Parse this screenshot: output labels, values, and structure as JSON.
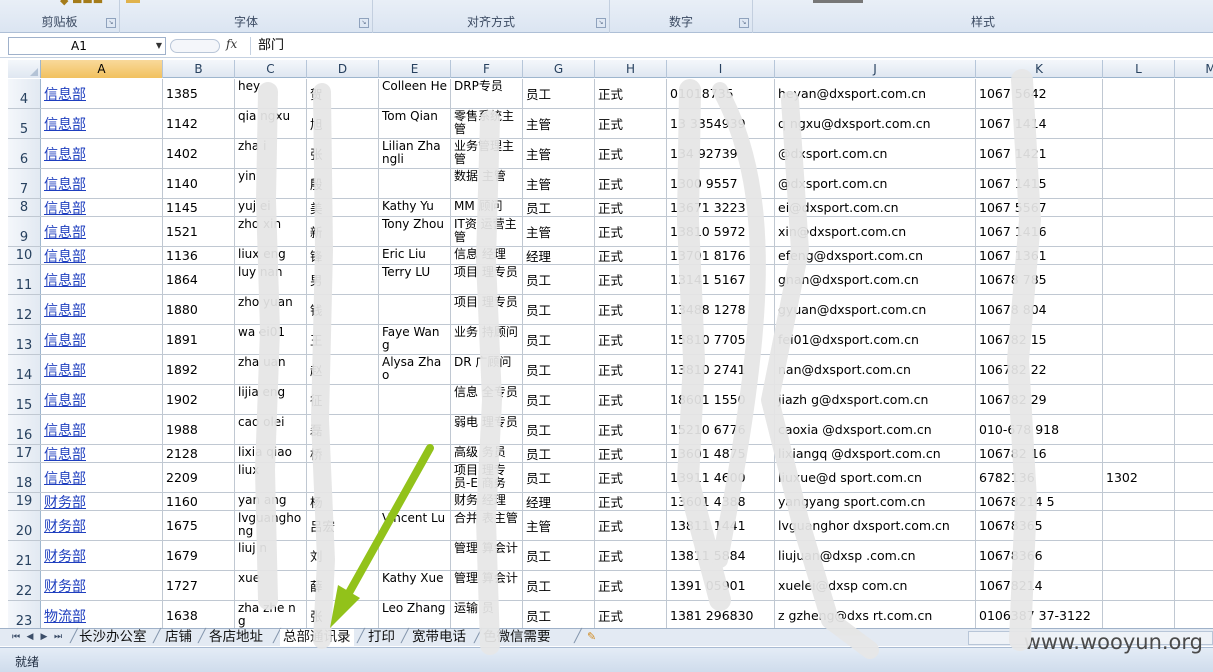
{
  "ribbon": {
    "groups": [
      {
        "label": "剪贴板"
      },
      {
        "label": "字体"
      },
      {
        "label": "对齐方式"
      },
      {
        "label": "数字"
      },
      {
        "label": "样式"
      }
    ]
  },
  "formula_bar": {
    "name_box": "A1",
    "fx": "fx",
    "content": "部门"
  },
  "columns": [
    "A",
    "B",
    "C",
    "D",
    "E",
    "F",
    "G",
    "H",
    "I",
    "J",
    "K",
    "L",
    "M"
  ],
  "rows": [
    {
      "n": "4",
      "a": "信息部",
      "b": "1385",
      "c": "hey",
      "d": "贺",
      "e": "Colleen He",
      "f": "DRP专员",
      "g": "员工",
      "h": "正式",
      "i": "01018735",
      "j": "heyan@dxsport.com.cn",
      "k": "1067    5642",
      "l": ""
    },
    {
      "n": "5",
      "a": "信息部",
      "b": "1142",
      "c": "qia   ngxu",
      "d": "旭",
      "e": "Tom Qian",
      "f": "零售系统主管",
      "g": "主管",
      "h": "正式",
      "i": "13   3354939",
      "j": "q    ngxu@dxsport.com.cn",
      "k": "1067   1414",
      "l": ""
    },
    {
      "n": "6",
      "a": "信息部",
      "b": "1402",
      "c": "zha   i",
      "d": "张",
      "e": "Lilian Zhangli",
      "f": "业务管理主管",
      "g": "主管",
      "h": "正式",
      "i": "134   92739",
      "j": "    @dxsport.com.cn",
      "k": "1067   1421",
      "l": ""
    },
    {
      "n": "7",
      "a": "信息部",
      "b": "1140",
      "c": "yin",
      "d": "殷",
      "e": "",
      "f": "数据   主管",
      "g": "主管",
      "h": "正式",
      "i": "1300   9557",
      "j": "     @dxsport.com.cn",
      "k": "1067   1415",
      "l": ""
    },
    {
      "n": "8",
      "a": "信息部",
      "b": "1145",
      "c": "yuj   ei",
      "d": "美",
      "e": "Kathy Yu",
      "f": "MM   顾问",
      "g": "员工",
      "h": "正式",
      "i": "13671   3223",
      "j": "   ei@dxsport.com.cn",
      "k": "1067   5567",
      "l": ""
    },
    {
      "n": "9",
      "a": "信息部",
      "b": "1521",
      "c": "zho   xin",
      "d": "新",
      "e": "Tony Zhou",
      "f": "IT资   运营主管",
      "g": "主管",
      "h": "正式",
      "i": "13810   5972",
      "j": "    xin@dxsport.com.cn",
      "k": "1067   1416",
      "l": ""
    },
    {
      "n": "10",
      "a": "信息部",
      "b": "1136",
      "c": "liux   eng",
      "d": "锋",
      "e": "Eric Liu",
      "f": "信息   经理",
      "g": "经理",
      "h": "正式",
      "i": "13701   8176",
      "j": "    efeng@dxsport.com.cn",
      "k": "1067   1361",
      "l": ""
    },
    {
      "n": "11",
      "a": "信息部",
      "b": "1864",
      "c": "luy   nan",
      "d": "男",
      "e": "Terry LU",
      "f": "项目   理专员",
      "g": "员工",
      "h": "正式",
      "i": "13141   5167",
      "j": "    gnan@dxsport.com.cn",
      "k": "10678   785",
      "l": ""
    },
    {
      "n": "12",
      "a": "信息部",
      "b": "1880",
      "c": "zho   yuan",
      "d": "钱",
      "e": "",
      "f": "项目   理专员",
      "g": "员工",
      "h": "正式",
      "i": "13488   1278",
      "j": "   gyuan@dxsport.com.cn",
      "k": "10678   804",
      "l": ""
    },
    {
      "n": "13",
      "a": "信息部",
      "b": "1891",
      "c": "wa   ei01",
      "d": "王",
      "e": "Faye Wang",
      "f": "业务   持顾问",
      "g": "员工",
      "h": "正式",
      "i": "15810   7705",
      "j": "    fei01@dxsport.com.cn",
      "k": "106782   15",
      "l": ""
    },
    {
      "n": "14",
      "a": "信息部",
      "b": "1892",
      "c": "zha   uan",
      "d": "赵",
      "e": "Alysa Zhao",
      "f": "DR   广顾问",
      "g": "员工",
      "h": "正式",
      "i": "13810   2741",
      "j": "    nan@dxsport.com.cn",
      "k": "106782   22",
      "l": ""
    },
    {
      "n": "15",
      "a": "信息部",
      "b": "1902",
      "c": "lijia   eng",
      "d": "征",
      "e": "",
      "f": "信息   全专员",
      "g": "员工",
      "h": "正式",
      "i": "18601   1550",
      "j": "jiazh   g@dxsport.com.cn",
      "k": "106782   29",
      "l": ""
    },
    {
      "n": "16",
      "a": "信息部",
      "b": "1988",
      "c": "cao   olei",
      "d": "磊",
      "e": "",
      "f": "弱电   理专员",
      "g": "员工",
      "h": "正式",
      "i": "15210   6776",
      "j": "caoxia   @dxsport.com.cn",
      "k": "010-678   918",
      "l": ""
    },
    {
      "n": "17",
      "a": "信息部",
      "b": "2128",
      "c": "lixia   qiao",
      "d": "桥",
      "e": "",
      "f": "高级   务员",
      "g": "员工",
      "h": "正式",
      "i": "13601   4875",
      "j": "lixiangq   @dxsport.com.cn",
      "k": "106782   16",
      "l": ""
    },
    {
      "n": "18",
      "a": "信息部",
      "b": "2209",
      "c": "liux",
      "d": "",
      "e": "",
      "f": "项目   理专员-E   商务",
      "g": "员工",
      "h": "正式",
      "i": "13911   4600",
      "j": "liuxue@d   sport.com.cn",
      "k": "6782136",
      "l": "1302"
    },
    {
      "n": "19",
      "a": "财务部",
      "b": "1160",
      "c": "yan   ang",
      "d": "杨",
      "e": "",
      "f": "财务   经理",
      "g": "经理",
      "h": "正式",
      "i": "13601   4388",
      "j": "yangyang   sport.com.cn",
      "k": "10678214   5",
      "l": ""
    },
    {
      "n": "20",
      "a": "财务部",
      "b": "1675",
      "c": "lvguangho ng",
      "d": "吕宏",
      "e": "Vincent Lui",
      "f": "合并   表主管",
      "g": "主管",
      "h": "正式",
      "i": "13811   1441",
      "j": "lvguanghor   dxsport.com.cn",
      "k": "10678365",
      "l": ""
    },
    {
      "n": "21",
      "a": "财务部",
      "b": "1679",
      "c": "liuj   n",
      "d": "刘",
      "e": "",
      "f": "管理   算会计",
      "g": "员工",
      "h": "正式",
      "i": "13811   5884",
      "j": "liujuan@dxsp   .com.cn",
      "k": "10678366",
      "l": ""
    },
    {
      "n": "22",
      "a": "财务部",
      "b": "1727",
      "c": "xue",
      "d": "薛",
      "e": "Kathy Xue",
      "f": "管理   算会计",
      "g": "员工",
      "h": "正式",
      "i": "1391   05901",
      "j": "xuelei@dxsp   com.cn",
      "k": "10678214",
      "l": ""
    },
    {
      "n": "23",
      "a": "物流部",
      "b": "1638",
      "c": "zha   zhe ng",
      "d": "张",
      "e": "Leo Zhang",
      "f": "运输   员",
      "g": "员工",
      "h": "正式",
      "i": "1381   296830",
      "j": "z   gzheng@dxs   rt.com.cn",
      "k": "0106387   37-3122",
      "l": ""
    }
  ],
  "sheet_tabs": [
    "长沙办公室",
    "店铺",
    "各店地址",
    "总部通讯录",
    "打印",
    "宽带电话",
    "   色微信需要"
  ],
  "status": "就绪",
  "watermark": "www.wooyun.org"
}
